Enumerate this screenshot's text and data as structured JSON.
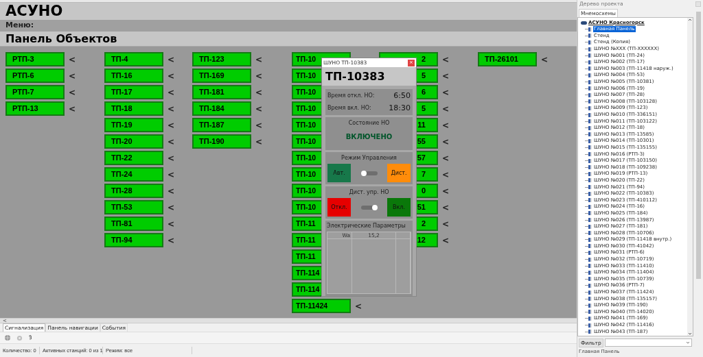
{
  "app_title": "АСУНО",
  "menu_label": "Меню:",
  "panel_title": "Панель Объектов",
  "columns": [
    {
      "items": [
        {
          "label": "РТП-3",
          "arrow": "<"
        },
        {
          "label": "РТП-6",
          "arrow": "<"
        },
        {
          "label": "РТП-7",
          "arrow": "<"
        },
        {
          "label": "РТП-13",
          "arrow": "<"
        }
      ]
    },
    {
      "items": [
        {
          "label": "ТП-4",
          "arrow": "<"
        },
        {
          "label": "ТП-16",
          "arrow": "<"
        },
        {
          "label": "ТП-17",
          "arrow": "<"
        },
        {
          "label": "ТП-18",
          "arrow": "<"
        },
        {
          "label": "ТП-19",
          "arrow": "<"
        },
        {
          "label": "ТП-20",
          "arrow": "<"
        },
        {
          "label": "ТП-22",
          "arrow": "<"
        },
        {
          "label": "ТП-24",
          "arrow": "<"
        },
        {
          "label": "ТП-28",
          "arrow": "<"
        },
        {
          "label": "ТП-53",
          "arrow": "<"
        },
        {
          "label": "ТП-81",
          "arrow": "<"
        },
        {
          "label": "ТП-94",
          "arrow": "<"
        }
      ]
    },
    {
      "items": [
        {
          "label": "ТП-123",
          "arrow": "<"
        },
        {
          "label": "ТП-169",
          "arrow": "<"
        },
        {
          "label": "ТП-181",
          "arrow": "<"
        },
        {
          "label": "ТП-184",
          "arrow": "<"
        },
        {
          "label": "ТП-187",
          "arrow": "<"
        },
        {
          "label": "ТП-190",
          "arrow": "<"
        }
      ]
    },
    {
      "items": [
        {
          "label": "ТП-10"
        },
        {
          "label": "ТП-10"
        },
        {
          "label": "ТП-10"
        },
        {
          "label": "ТП-10"
        },
        {
          "label": "ТП-10"
        },
        {
          "label": "ТП-10"
        },
        {
          "label": "ТП-10"
        },
        {
          "label": "ТП-10"
        },
        {
          "label": "ТП-10"
        },
        {
          "label": "ТП-10"
        },
        {
          "label": "ТП-11"
        },
        {
          "label": "ТП-11"
        },
        {
          "label": "ТП-11"
        },
        {
          "label": "ТП-114"
        },
        {
          "label": "ТП-114"
        },
        {
          "label": "ТП-11424",
          "arrow": "<"
        }
      ]
    },
    {
      "items": [
        {
          "label": "2",
          "arrow": "<"
        },
        {
          "label": "5",
          "arrow": "<"
        },
        {
          "label": "6",
          "arrow": "<"
        },
        {
          "label": "5",
          "arrow": "<"
        },
        {
          "label": "11",
          "arrow": "<"
        },
        {
          "label": "55",
          "arrow": "<"
        },
        {
          "label": "57",
          "arrow": "<"
        },
        {
          "label": "7",
          "arrow": "<"
        },
        {
          "label": "0",
          "arrow": "<"
        },
        {
          "label": "51",
          "arrow": "<"
        },
        {
          "label": "2",
          "arrow": "<"
        },
        {
          "label": "12",
          "arrow": "<"
        }
      ]
    },
    {
      "items": [
        {
          "label": "ТП-26101",
          "arrow": "<"
        }
      ]
    }
  ],
  "dialog": {
    "title": "ШУНО ТП-10383",
    "close": "×",
    "header": "ТП-10383",
    "times": [
      {
        "label": "Время откл. НО:",
        "value": "6:50"
      },
      {
        "label": "Время вкл. НО:",
        "value": "18:30"
      }
    ],
    "state": {
      "title": "Состояние НО",
      "value": "ВКЛЮЧЕНО"
    },
    "mode": {
      "title": "Режим Управления",
      "left": "Авт.",
      "right": "Дист.",
      "on": false
    },
    "remote": {
      "title": "Дист. упр. НО",
      "left": "Откл.",
      "right": "Вкл.",
      "on": true
    },
    "params": {
      "title": "Электрические Параметры",
      "rows": [
        [
          "Wa",
          "15,2",
          ""
        ]
      ]
    }
  },
  "bottom": {
    "scroll_arrow": "<",
    "tabs": [
      {
        "label": "Сигнализация",
        "selected": true
      },
      {
        "label": "Панель навигации",
        "selected": false
      },
      {
        "label": "События",
        "selected": false
      }
    ],
    "status": [
      "Количество: 0",
      "Активных станций: 0 из 1",
      "Режим: все"
    ]
  },
  "project_tree": {
    "title": "Дерево проекта",
    "tab": "Мнемосхемы",
    "root": "АСУНО Красногорск",
    "children": [
      {
        "label": "Главная Панель",
        "selected": true
      },
      {
        "label": "Стенд",
        "selected": false
      },
      {
        "label": "Стенд (Копия)",
        "selected": false
      },
      {
        "label": "ШУНО №XXX (ТП-XXXXXX)",
        "selected": false
      },
      {
        "label": "ШУНО №001 (ТП-24)",
        "selected": false
      },
      {
        "label": "ШУНО №002 (ТП-17)",
        "selected": false
      },
      {
        "label": "ШУНО №003 (ТП-11418 наруж.)",
        "selected": false
      },
      {
        "label": "ШУНО №004 (ТП-53)",
        "selected": false
      },
      {
        "label": "ШУНО №005 (ТП-10381)",
        "selected": false
      },
      {
        "label": "ШУНО №006 (ТП-19)",
        "selected": false
      },
      {
        "label": "ШУНО №007 (ТП-28)",
        "selected": false
      },
      {
        "label": "ШУНО №008 (ТП-103128)",
        "selected": false
      },
      {
        "label": "ШУНО №009 (ТП-123)",
        "selected": false
      },
      {
        "label": "ШУНО №010 (ТП-336151)",
        "selected": false
      },
      {
        "label": "ШУНО №011 (ТП-103122)",
        "selected": false
      },
      {
        "label": "ШУНО №012 (ТП-18)",
        "selected": false
      },
      {
        "label": "ШУНО №013 (ТП-13585)",
        "selected": false
      },
      {
        "label": "ШУНО №014 (ТП-10301)",
        "selected": false
      },
      {
        "label": "ШУНО №015 (ТП-135155)",
        "selected": false
      },
      {
        "label": "ШУНО №016 (РТП-3)",
        "selected": false
      },
      {
        "label": "ШУНО №017 (ТП-103150)",
        "selected": false
      },
      {
        "label": "ШУНО №018 (ТП-109238)",
        "selected": false
      },
      {
        "label": "ШУНО №019 (РТП-13)",
        "selected": false
      },
      {
        "label": "ШУНО №020 (ТП-22)",
        "selected": false
      },
      {
        "label": "ШУНО №021 (ТП-94)",
        "selected": false
      },
      {
        "label": "ШУНО №022 (ТП-10383)",
        "selected": false
      },
      {
        "label": "ШУНО №023 (ТП-410112)",
        "selected": false
      },
      {
        "label": "ШУНО №024 (ТП-16)",
        "selected": false
      },
      {
        "label": "ШУНО №025 (ТП-184)",
        "selected": false
      },
      {
        "label": "ШУНО №026 (ТП-13987)",
        "selected": false
      },
      {
        "label": "ШУНО №027 (ТП-181)",
        "selected": false
      },
      {
        "label": "ШУНО №028 (ТП-10706)",
        "selected": false
      },
      {
        "label": "ШУНО №029 (ТП-11418 внутр.)",
        "selected": false
      },
      {
        "label": "ШУНО №030 (ТП-41042)",
        "selected": false
      },
      {
        "label": "ШУНО №031 (РТП-6)",
        "selected": false
      },
      {
        "label": "ШУНО №032 (ТП-10719)",
        "selected": false
      },
      {
        "label": "ШУНО №033 (ТП-11410)",
        "selected": false
      },
      {
        "label": "ШУНО №034 (ТП-11404)",
        "selected": false
      },
      {
        "label": "ШУНО №035 (ТП-10739)",
        "selected": false
      },
      {
        "label": "ШУНО №036 (РТП-7)",
        "selected": false
      },
      {
        "label": "ШУНО №037 (ТП-11424)",
        "selected": false
      },
      {
        "label": "ШУНО №038 (ТП-135157)",
        "selected": false
      },
      {
        "label": "ШУНО №039 (ТП-190)",
        "selected": false
      },
      {
        "label": "ШУНО №040 (ТП-14020)",
        "selected": false
      },
      {
        "label": "ШУНО №041 (ТП-169)",
        "selected": false
      },
      {
        "label": "ШУНО №042 (ТП-11416)",
        "selected": false
      },
      {
        "label": "ШУНО №043 (ТП-187)",
        "selected": false
      }
    ],
    "filter_label": "Фильтр",
    "status": "Главная Панель"
  }
}
